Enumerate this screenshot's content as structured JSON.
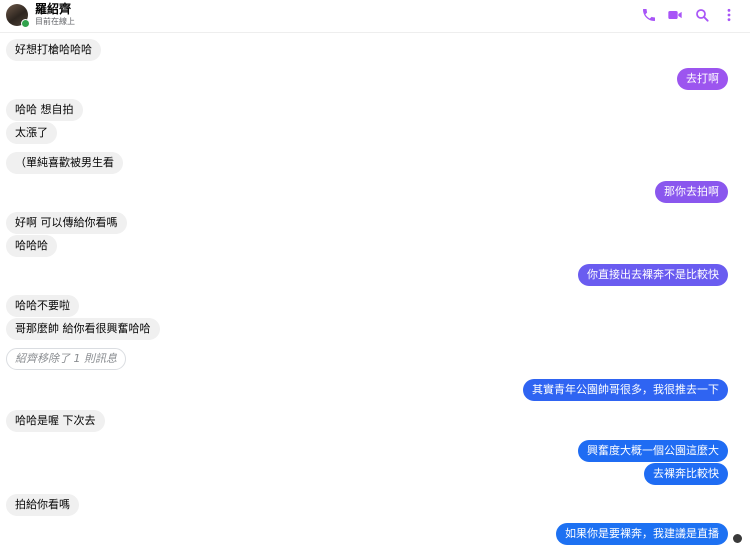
{
  "header": {
    "name": "羅紹齊",
    "status": "目前在線上",
    "accent": "#a855f7",
    "icons": [
      "phone-icon",
      "video-icon",
      "search-icon",
      "more-options-icon"
    ]
  },
  "messages": [
    {
      "dir": "in",
      "text": "好想打槍哈哈哈"
    },
    {
      "dir": "out",
      "text": "去打啊",
      "color": "#9c55ef"
    },
    {
      "dir": "in",
      "text": "哈哈 想自拍"
    },
    {
      "dir": "in",
      "text": "太漲了"
    },
    {
      "dir": "in",
      "text": "（單純喜歡被男生看"
    },
    {
      "dir": "out",
      "text": "那你去拍啊",
      "color": "#8a57ee"
    },
    {
      "dir": "in",
      "text": "好啊 可以傳給你看嗎"
    },
    {
      "dir": "in",
      "text": "哈哈哈"
    },
    {
      "dir": "out",
      "text": "你直接出去裸奔不是比較快",
      "color": "#6a5cf0"
    },
    {
      "dir": "in",
      "text": "哈哈不要啦"
    },
    {
      "dir": "in",
      "text": "哥那麼帥 給你看很興奮哈哈"
    },
    {
      "dir": "in",
      "text": "紹齊移除了 1 則訊息",
      "removed": true
    },
    {
      "dir": "out",
      "text": "其實青年公園帥哥很多，我很推去一下",
      "color": "#2f64f2"
    },
    {
      "dir": "in",
      "text": "哈哈是喔 下次去"
    },
    {
      "dir": "out",
      "text": "興奮度大概一個公園這麼大",
      "color": "#1f6cf3"
    },
    {
      "dir": "out",
      "text": "去裸奔比較快",
      "color": "#1f6cf3"
    },
    {
      "dir": "in",
      "text": "拍給你看嗎"
    },
    {
      "dir": "out",
      "text": "如果你是要裸奔，我建議是直播",
      "color": "#1d71f2"
    }
  ]
}
